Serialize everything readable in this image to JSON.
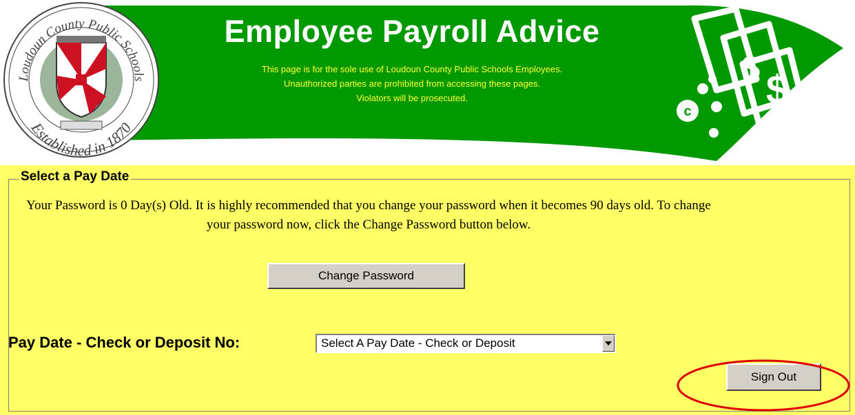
{
  "header": {
    "title": "Employee Payroll Advice",
    "notice": [
      "This page is for the sole use of Loudoun County Public Schools Employees.",
      "Unauthorized parties are prohibited from accessing these pages.",
      "Violators will be prosecuted."
    ],
    "seal": {
      "top_text": "Loudoun County Public Schools",
      "bottom_text": "Established in 1870"
    },
    "colors": {
      "banner": "#009900",
      "title": "#ffffff",
      "notice": "#ffff33"
    },
    "decor_icon": "money-bills-icon"
  },
  "panel": {
    "legend": "Select a Pay Date",
    "password_message": "Your Password is 0 Day(s) Old. It is highly recommended that you change your password when it becomes 90 days old. To change your password now, click the Change Password button below.",
    "change_password_label": "Change Password",
    "pay_date_label": "Pay Date - Check or Deposit No:",
    "pay_date_selected": "Select A Pay Date - Check or Deposit",
    "sign_out_label": "Sign Out",
    "colors": {
      "background": "#ffff66",
      "highlight_circle": "#dd0000"
    }
  }
}
